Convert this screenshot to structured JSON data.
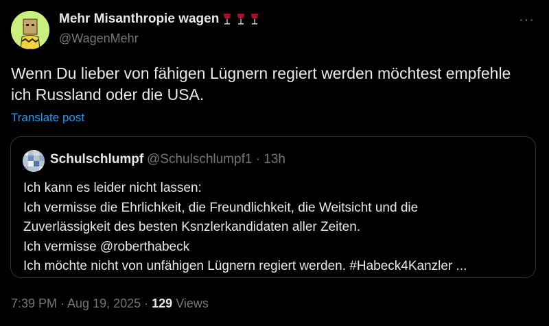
{
  "author": {
    "name": "Mehr Misanthropie wagen",
    "handle": "@WagenMehr",
    "name_emoji": [
      "wine-glass-icon",
      "wine-glass-icon",
      "wine-glass-icon"
    ]
  },
  "more_label": "···",
  "post": {
    "text_line1": "Wenn Du lieber von fähigen Lügnern regiert werden möchtest empfehle",
    "text_line2": "ich Russland oder die USA.",
    "translate_label": "Translate post"
  },
  "quote": {
    "name": "Schulschlumpf",
    "handle_time": "@Schulschlumpf1 · 13h",
    "lines": [
      "Ich kann es leider nicht lassen:",
      "Ich vermisse die Ehrlichkeit, die Freundlichkeit, die Weitsicht und die",
      "Zuverlässigkeit des besten Ksnzlerkandidaten aller Zeiten.",
      "Ich vermisse @roberthabeck",
      "Ich möchte nicht von unfähigen Lügnern regiert werden. #Habeck4Kanzler ..."
    ]
  },
  "meta": {
    "time_date": "7:39 PM · Aug 19, 2025 · ",
    "views_count": "129",
    "views_label": " Views"
  },
  "colors": {
    "background": "#000000",
    "text": "#e7e9ea",
    "muted": "#71767b",
    "link": "#1d9bf0",
    "border": "#2f3336",
    "wine": "#a3142c"
  }
}
